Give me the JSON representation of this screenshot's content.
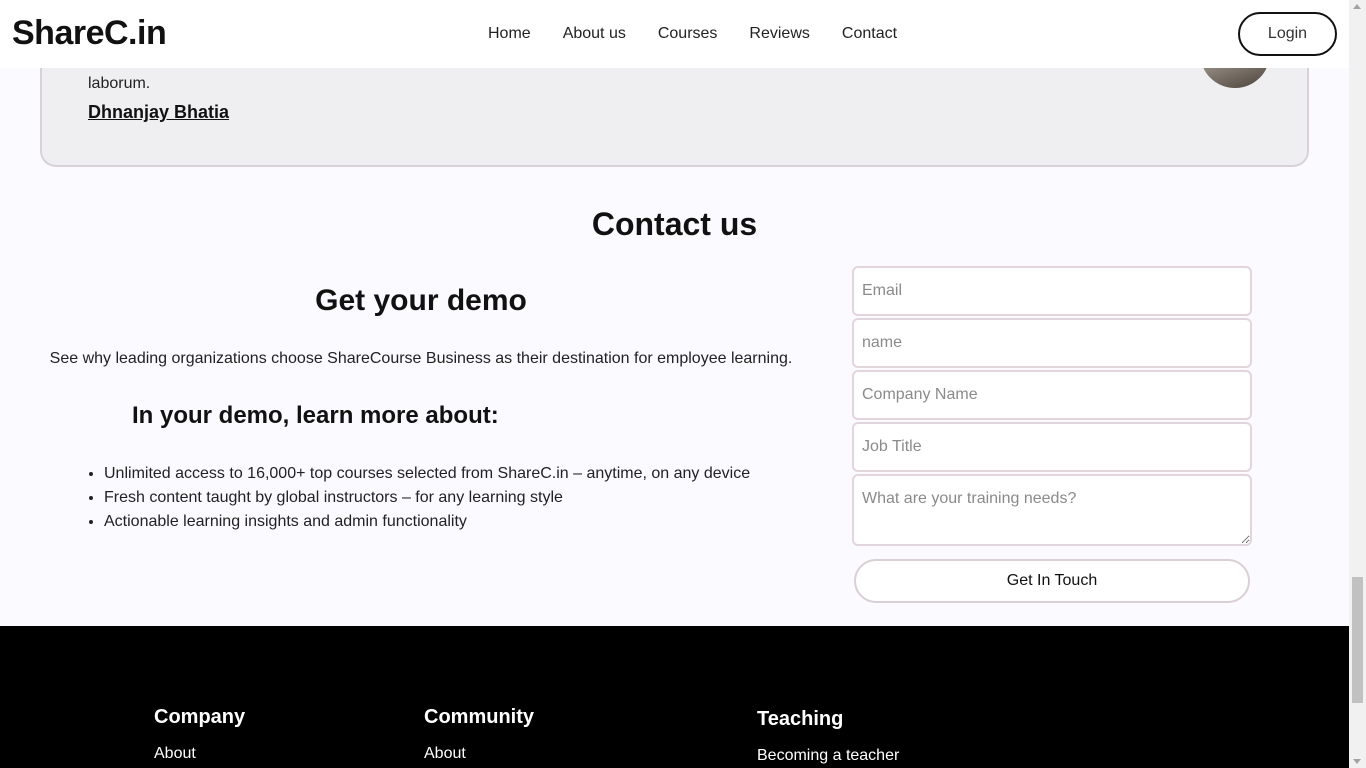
{
  "navbar": {
    "brand": "ShareC.in",
    "links": [
      "Home",
      "About us",
      "Courses",
      "Reviews",
      "Contact"
    ],
    "login_label": "Login"
  },
  "review": {
    "text_fragment": "laborum.",
    "author": "Dhnanjay Bhatia"
  },
  "contact": {
    "title": "Contact us",
    "demo_title": "Get your demo",
    "demo_description": "See why leading organizations choose ShareCourse Business as their destination for employee learning.",
    "learn_title": "In your demo, learn more about:",
    "learn_items": [
      "Unlimited access to 16,000+ top courses selected from ShareC.in – anytime, on any device",
      "Fresh content taught by global instructors – for any learning style",
      "Actionable learning insights and admin functionality"
    ],
    "form": {
      "email_placeholder": "Email",
      "name_placeholder": "name",
      "company_placeholder": "Company Name",
      "job_placeholder": "Job Title",
      "needs_placeholder": "What are your training needs?",
      "submit_label": "Get In Touch"
    }
  },
  "footer": {
    "columns": [
      {
        "heading": "Company",
        "links": [
          "About"
        ]
      },
      {
        "heading": "Community",
        "links": [
          "About"
        ]
      },
      {
        "heading": "Teaching",
        "links": [
          "Becoming a teacher"
        ]
      }
    ]
  }
}
